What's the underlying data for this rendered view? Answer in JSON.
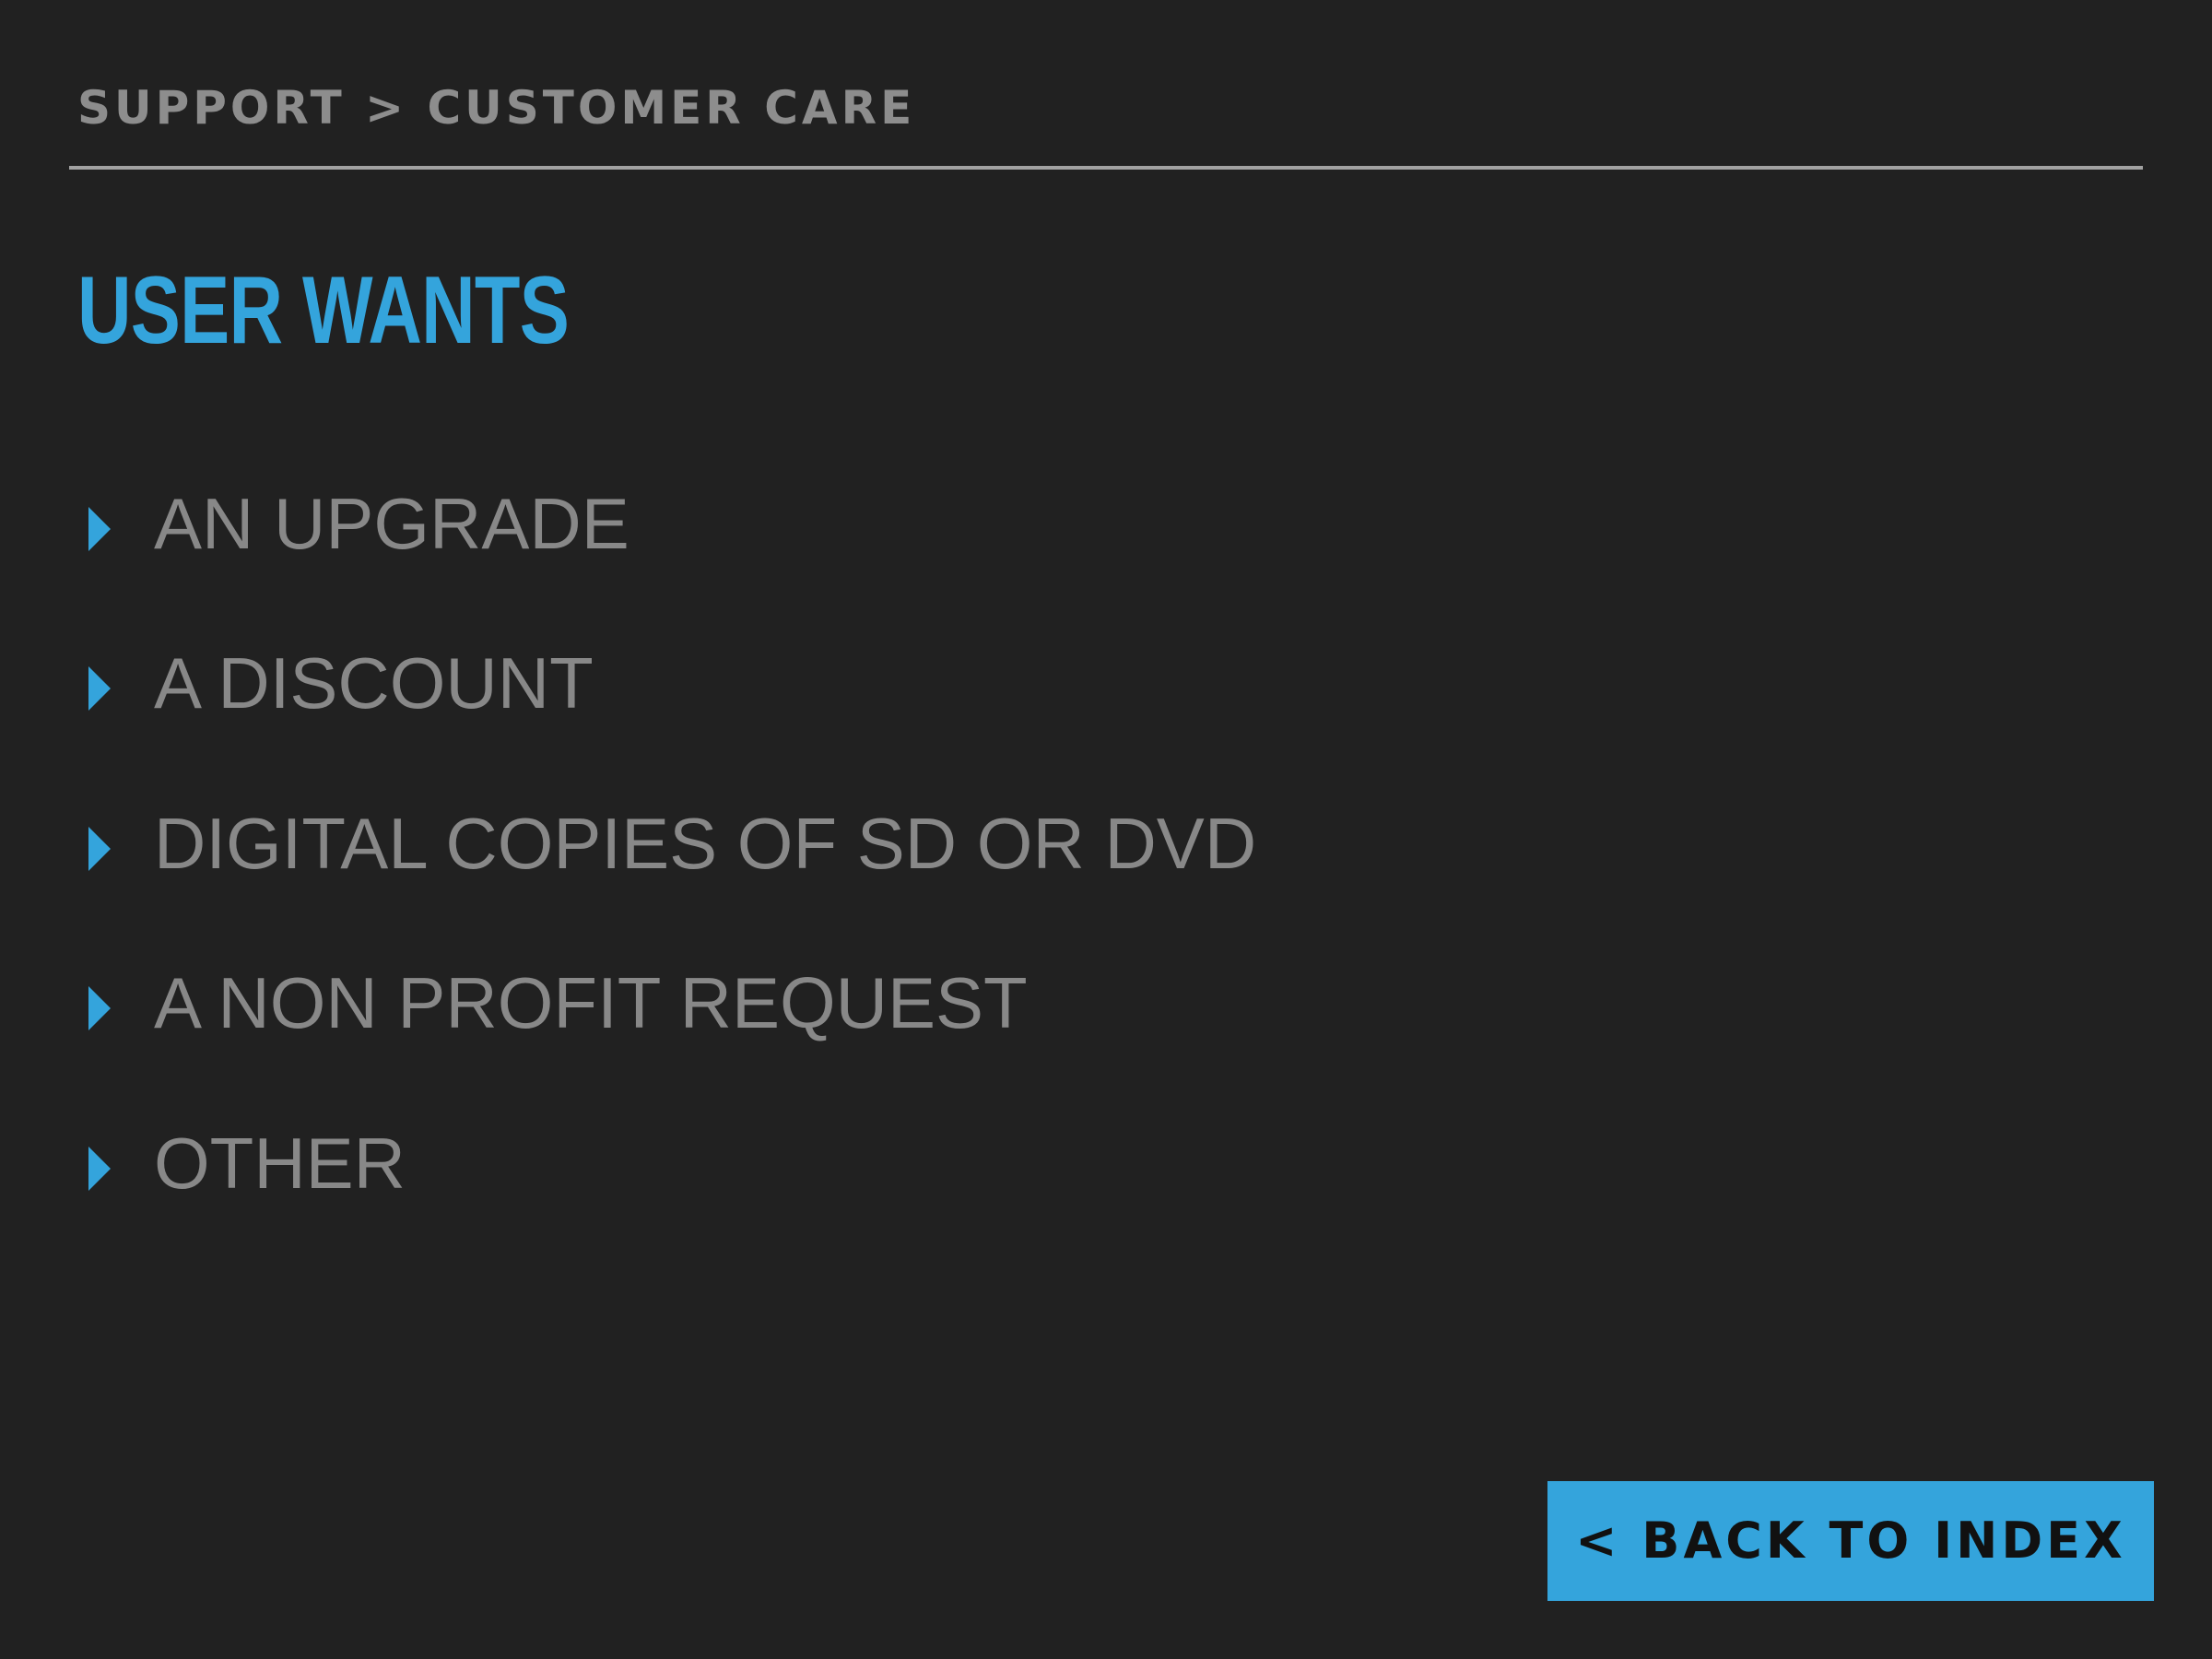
{
  "header": {
    "breadcrumb": "SUPPORT > CUSTOMER CARE",
    "title": "USER WANTS"
  },
  "list": {
    "items": [
      {
        "label": "AN UPGRADE"
      },
      {
        "label": "A DISCOUNT"
      },
      {
        "label": "DIGITAL COPIES OF SD OR DVD"
      },
      {
        "label": "A NON PROFIT REQUEST"
      },
      {
        "label": "OTHER"
      }
    ]
  },
  "footer": {
    "back_label": "< BACK TO INDEX"
  },
  "colors": {
    "background": "#212121",
    "accent": "#34a4dc",
    "text": "#888888",
    "divider": "#a2a2a2"
  }
}
